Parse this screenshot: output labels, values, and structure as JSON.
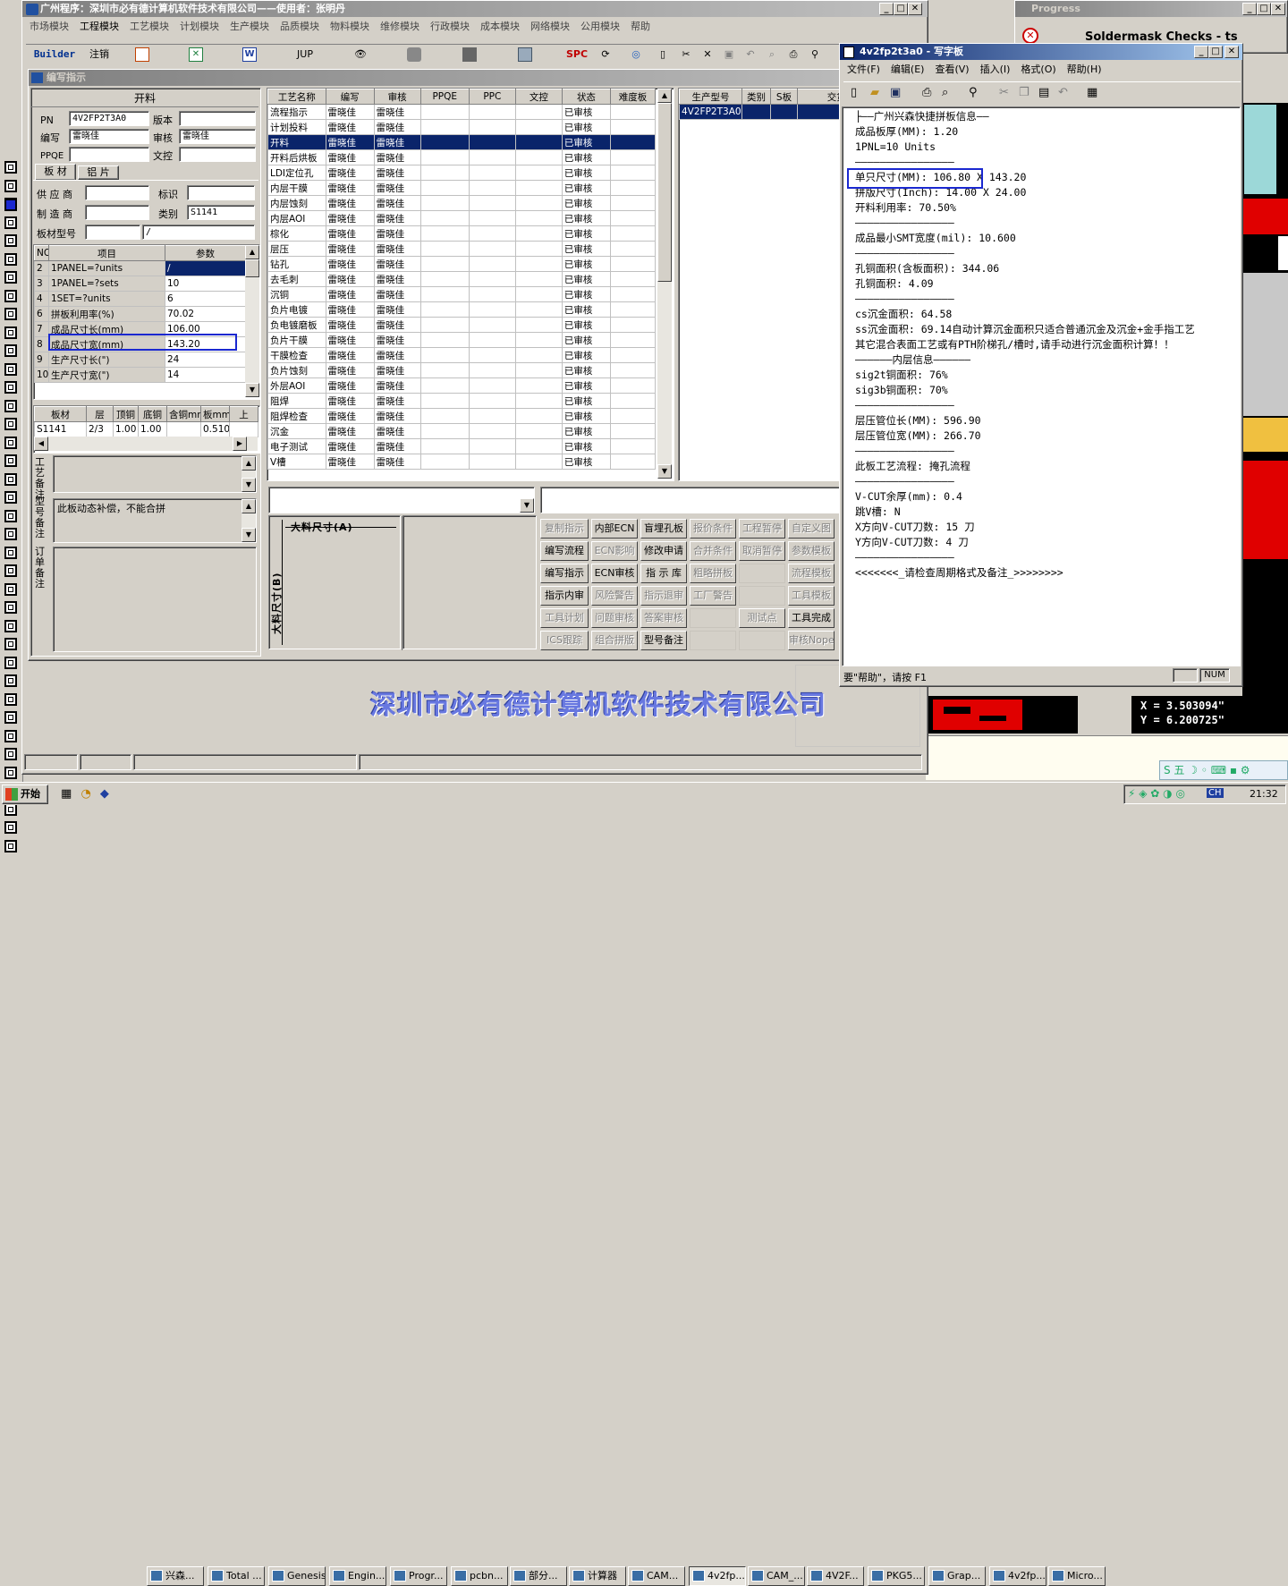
{
  "main": {
    "title": "广州程序：深圳市必有德计算机软件技术有限公司——使用者：张明丹",
    "menu": [
      "市场模块",
      "工程模块",
      "工艺模块",
      "计划模块",
      "生产模块",
      "品质模块",
      "物料模块",
      "维修模块",
      "行政模块",
      "成本模块",
      "网络模块",
      "公用模块",
      "帮助"
    ],
    "toolbar": {
      "builder": "Builder",
      "logout": "注销",
      "jup": "JUP",
      "spc": "SPC"
    },
    "company_banner": "深圳市必有德计算机软件技术有限公司"
  },
  "child": {
    "title": "编写指示",
    "section": "开料",
    "labels": {
      "pn": "PN",
      "version": "版本",
      "writer": "编写",
      "auditor": "审核",
      "ppqe": "PPQE",
      "wenkong": "文控",
      "supplier": "供 应 商",
      "mark": "标识",
      "maker": "制 造 商",
      "category": "类别",
      "model": "板材型号"
    },
    "values": {
      "pn": "4V2FP2T3A0",
      "writer": "雷晓佳",
      "auditor": "雷晓佳",
      "category": "S1141",
      "model_right": "/"
    },
    "tabs": [
      "板 材",
      "铝 片"
    ],
    "params_header": [
      "NO",
      "项目",
      "参数"
    ],
    "params": [
      [
        "2",
        "1PANEL=?units",
        "/"
      ],
      [
        "3",
        "1PANEL=?sets",
        "10"
      ],
      [
        "4",
        "1SET=?units",
        "6"
      ],
      [
        "6",
        "拼板利用率(%)",
        "70.02"
      ],
      [
        "7",
        "成品尺寸长(mm)",
        "106.00"
      ],
      [
        "8",
        "成品尺寸宽(mm)",
        "143.20"
      ],
      [
        "9",
        "生产尺寸长(\")",
        "24"
      ],
      [
        "10",
        "生产尺寸宽(\")",
        "14"
      ]
    ],
    "material_header": [
      "板材",
      "层",
      "顶铜",
      "底铜",
      "含铜mm",
      "板mm",
      "上"
    ],
    "material_row": [
      "S1141",
      "2/3",
      "1.00",
      "1.00",
      "",
      "0.510",
      ""
    ],
    "notes_labels": [
      "工艺备注",
      "型号备注",
      "订单备注"
    ],
    "model_note": "此板动态补偿，不能合拼",
    "process_header": [
      "工艺名称",
      "编写",
      "审核",
      "PPQE",
      "PPC",
      "文控",
      "状态",
      "难度板"
    ],
    "processes": [
      "流程指示",
      "计划投料",
      "开料",
      "开料后烘板",
      "LDI定位孔",
      "内层干膜",
      "内层蚀刻",
      "内层AOI",
      "棕化",
      "层压",
      "钻孔",
      "去毛刺",
      "沉铜",
      "负片电镀",
      "负电镀磨板",
      "负片干膜",
      "干膜检查",
      "负片蚀刻",
      "外层AOI",
      "阻焊",
      "阻焊检查",
      "沉金",
      "电子测试",
      "V槽"
    ],
    "process_writer": "雷晓佳",
    "process_auditor": "雷晓佳",
    "process_status": "已审核",
    "selected_index": 2,
    "prod_header": [
      "生产型号",
      "类别",
      "S板",
      "交货期"
    ],
    "prod_row": [
      "4V2FP2T3A0",
      "",
      "",
      ""
    ],
    "dim_a": "大料尺寸(A)",
    "dim_b": "大料尺寸(B)",
    "buttons": [
      [
        "复制指示",
        "内部ECN",
        "盲埋孔板",
        "报价条件",
        "工程暂停",
        "自定义图"
      ],
      [
        "编写流程",
        "ECN影响",
        "修改申请",
        "合并条件",
        "取消暂停",
        "参数模板"
      ],
      [
        "编写指示",
        "ECN审核",
        "指 示 库",
        "粗略拼板",
        "",
        "流程模板"
      ],
      [
        "指示内审",
        "风险警告",
        "指示退审",
        "工厂警告",
        "",
        "工具模板"
      ],
      [
        "工具计划",
        "问题审核",
        "答案审核",
        "",
        "测试点",
        "工具完成"
      ],
      [
        "ICS跟踪",
        "组合拼版",
        "型号备注",
        "",
        "",
        "审核Nope"
      ]
    ],
    "button_disabled": [
      [
        true,
        false,
        false,
        true,
        true,
        true
      ],
      [
        false,
        true,
        false,
        true,
        true,
        true
      ],
      [
        false,
        false,
        false,
        true,
        false,
        true
      ],
      [
        false,
        true,
        true,
        true,
        false,
        true
      ],
      [
        true,
        true,
        true,
        false,
        true,
        false
      ],
      [
        true,
        true,
        false,
        false,
        false,
        true
      ]
    ]
  },
  "wordpad": {
    "title": "4v2fp2t3a0 - 写字板",
    "menu": [
      "文件(F)",
      "编辑(E)",
      "查看(V)",
      "插入(I)",
      "格式(O)",
      "帮助(H)"
    ],
    "lines": [
      "├——广州兴森快捷拼板信息——",
      "成品板厚(MM): 1.20",
      "1PNL=10 Units",
      "————————————————",
      "单只尺寸(MM): 106.80 X 143.20",
      "拼版尺寸(Inch): 14.00 X 24.00",
      "开料利用率: 70.50%",
      "————————————————",
      "成品最小SMT宽度(mil): 10.600",
      "————————————————",
      "孔铜面积(含板面积): 344.06",
      "孔铜面积: 4.09",
      "————————————————",
      "cs沉金面积: 64.58",
      "ss沉金面积: 69.14自动计算沉金面积只适合普通沉金及沉金+金手指工艺",
      "其它混合表面工艺或有PTH阶梯孔/槽时,请手动进行沉金面积计算！！",
      "——————内层信息——————",
      "sig2t铜面积: 76%",
      "sig3b铜面积: 70%",
      "————————————————",
      "层压管位长(MM): 596.90",
      "层压管位宽(MM): 266.70",
      "————————————————",
      "此板工艺流程: 掩孔流程",
      "————————————————",
      "V-CUT余厚(mm): 0.4",
      "跳V槽: N",
      "X方向V-CUT刀数: 15 刀",
      "Y方向V-CUT刀数: 4 刀",
      "————————————————",
      "<<<<<<<_请检查周期格式及备注_>>>>>>>>"
    ],
    "status": "要\"帮助\"，请按 F1",
    "num": "NUM"
  },
  "progress": {
    "title": "Progress",
    "text": "Soldermask Checks - ts"
  },
  "coords": {
    "x": "X = 3.503094\"",
    "y": "Y = 6.200725\""
  },
  "taskbar": {
    "start": "开始",
    "tasks": [
      "兴森...",
      "Total ...",
      "Genesis",
      "Engin...",
      "Progr...",
      "pcbn...",
      "部分...",
      "计算器",
      "CAM...",
      "4v2fp...",
      "CAM_...",
      "4V2F...",
      "PKG5...",
      "Grap...",
      "4v2fp...",
      "Micro..."
    ],
    "active_index": 9,
    "clock": "21:32",
    "ime": "CH"
  }
}
